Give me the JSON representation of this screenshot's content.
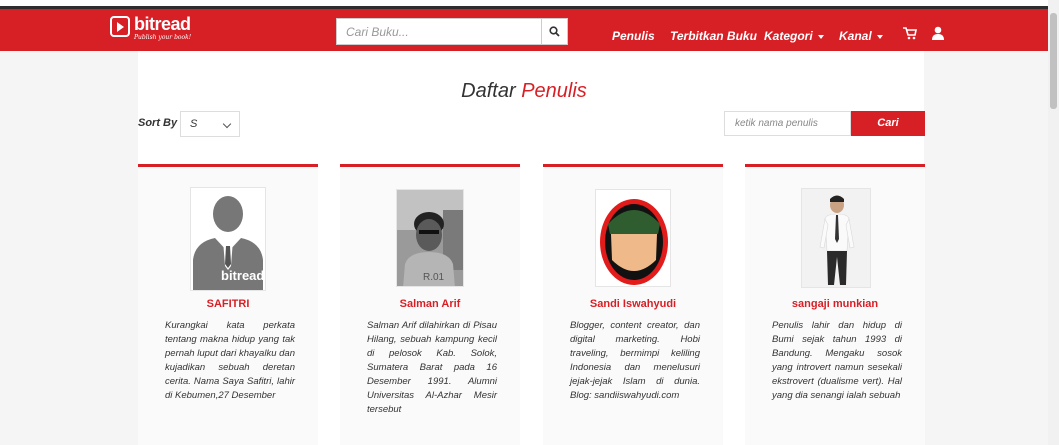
{
  "navbar": {
    "logo_name": "bitread",
    "logo_tagline": "Publish your book!",
    "search_placeholder": "Cari Buku...",
    "links": [
      {
        "label": "Penulis"
      },
      {
        "label": "Terbitkan Buku"
      },
      {
        "label": "Kategori"
      },
      {
        "label": "Kanal"
      }
    ]
  },
  "page": {
    "title_prefix": "Daftar",
    "title_highlight": "Penulis",
    "sort_label": "Sort By",
    "sort_value": "S",
    "author_search_placeholder": "ketik nama penulis",
    "author_search_button": "Cari"
  },
  "authors": [
    {
      "name": "SAFITRI",
      "photo_text": "bitread",
      "bio": "Kurangkai kata perkata tentang makna hidup yang tak pernah luput dari khayalku dan kujadikan sebuah deretan cerita. Nama Saya Safitri, lahir di Kebumen,27 Desember"
    },
    {
      "name": "Salman Arif",
      "bio": "Salman Arif dilahirkan di Pisau Hilang, sebuah kampung kecil di pelosok Kab. Solok, Sumatera Barat pada 16 Desember 1991. Alumni Universitas Al-Azhar Mesir tersebut"
    },
    {
      "name": "Sandi Iswahyudi",
      "bio": "Blogger, content creator, dan digital marketing. Hobi traveling, bermimpi keliling Indonesia dan menelusuri jejak-jejak Islam di dunia. Blog: sandiiswahyudi.com"
    },
    {
      "name": "sangaji munkian",
      "bio": "Penulis lahir dan hidup di Bumi sejak tahun 1993 di Bandung. Mengaku sosok yang introvert namun sesekali ekstrovert (dualisme vert). Hal yang dia senangi ialah sebuah"
    }
  ],
  "colors": {
    "brand_red": "#d71f26"
  }
}
